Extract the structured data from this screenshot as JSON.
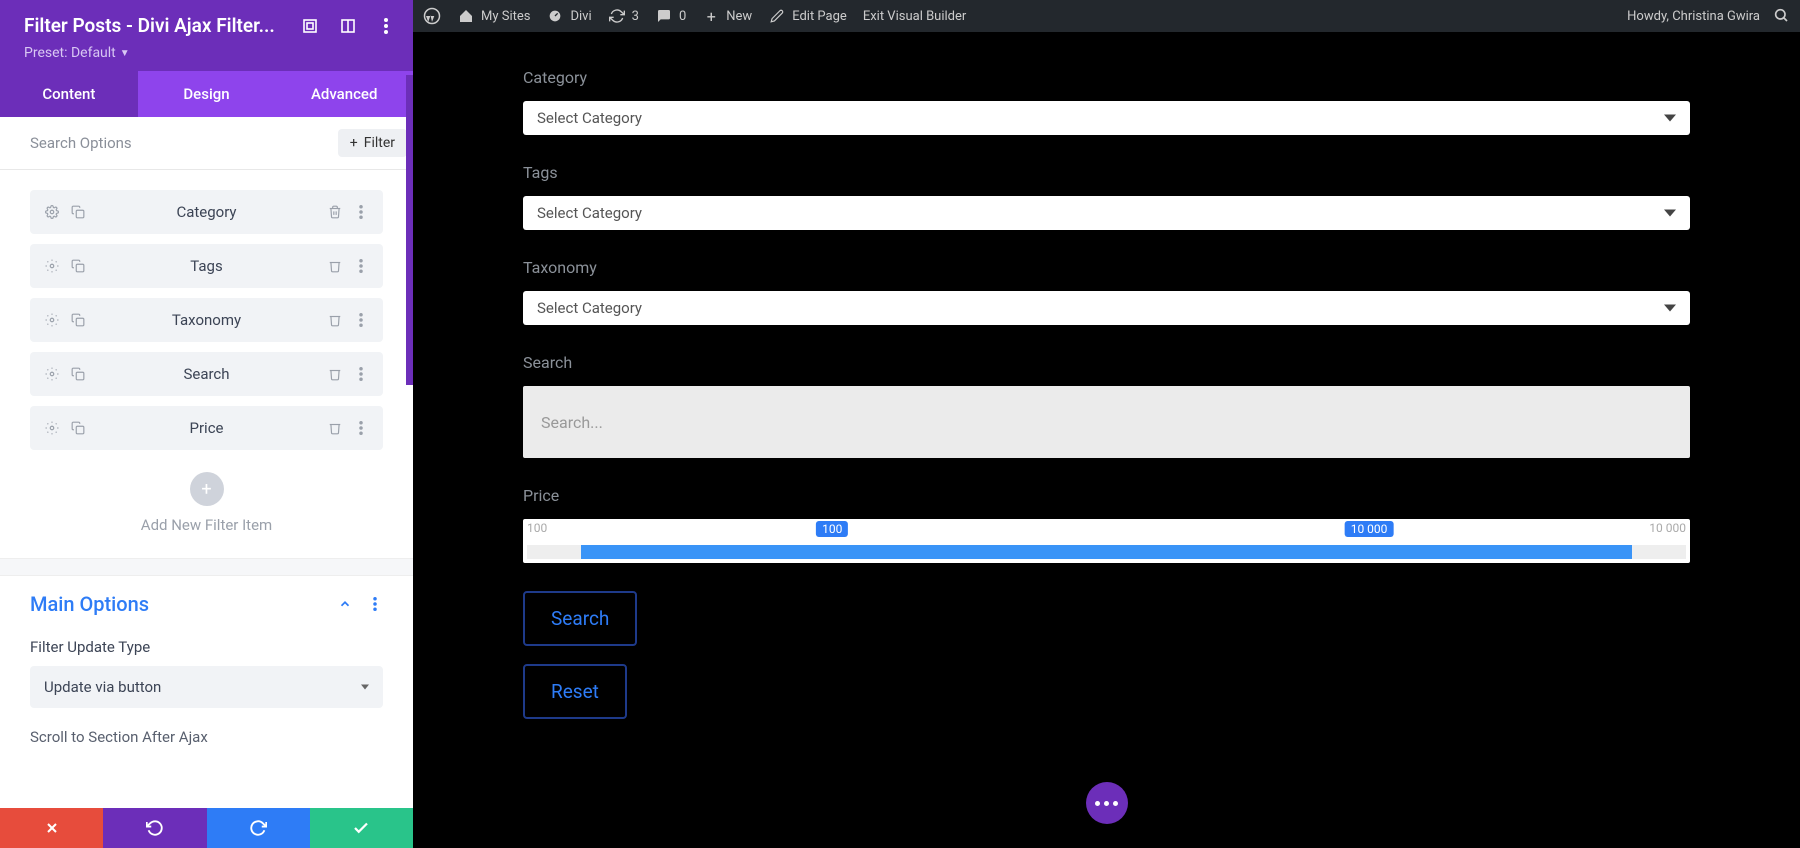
{
  "sidebar": {
    "title": "Filter Posts - Divi Ajax Filter...",
    "preset_label": "Preset: Default",
    "tabs": {
      "content": "Content",
      "design": "Design",
      "advanced": "Advanced"
    },
    "search_options_label": "Search Options",
    "add_filter_label": "Filter",
    "filter_items": [
      {
        "label": "Category"
      },
      {
        "label": "Tags"
      },
      {
        "label": "Taxonomy"
      },
      {
        "label": "Search"
      },
      {
        "label": "Price"
      }
    ],
    "add_new_label": "Add New Filter Item",
    "main_options_title": "Main Options",
    "filter_update_type_label": "Filter Update Type",
    "filter_update_type_value": "Update via button",
    "scroll_section_label": "Scroll to Section After Ajax"
  },
  "admin_bar": {
    "my_sites": "My Sites",
    "divi": "Divi",
    "updates": "3",
    "comments": "0",
    "new": "New",
    "edit_page": "Edit Page",
    "exit_vb": "Exit Visual Builder",
    "howdy": "Howdy, Christina Gwira"
  },
  "canvas": {
    "category_label": "Category",
    "tags_label": "Tags",
    "taxonomy_label": "Taxonomy",
    "select_placeholder": "Select Category",
    "search_label": "Search",
    "search_placeholder": "Search...",
    "price_label": "Price",
    "price_min": "100",
    "price_max": "10 000",
    "price_from": "100",
    "price_to": "10 000",
    "search_btn": "Search",
    "reset_btn": "Reset"
  }
}
